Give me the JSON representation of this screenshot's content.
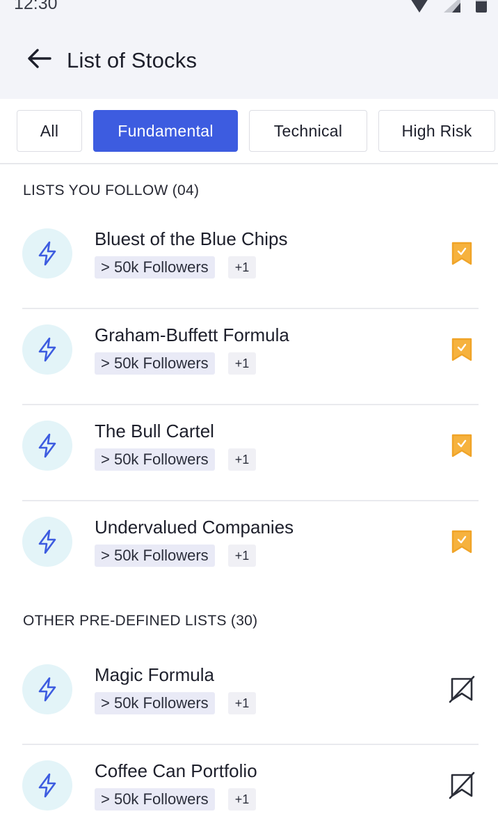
{
  "status_bar": {
    "time": "12:30",
    "icons": [
      "wifi-icon",
      "cell-signal-icon",
      "battery-icon"
    ]
  },
  "header": {
    "back_icon": "arrow-left-icon",
    "title": "List of Stocks"
  },
  "tabs": [
    {
      "label": "All",
      "active": false
    },
    {
      "label": "Fundamental",
      "active": true
    },
    {
      "label": "Technical",
      "active": false
    },
    {
      "label": "High Risk",
      "active": false
    }
  ],
  "sections": {
    "followed": {
      "title": "LISTS YOU FOLLOW (04)",
      "items": [
        {
          "title": "Bluest of the Blue Chips",
          "followers": "> 50k Followers",
          "extra": "+1",
          "icon": "lightning-icon",
          "action_icon": "bookmark-filled-icon"
        },
        {
          "title": "Graham-Buffett Formula",
          "followers": "> 50k Followers",
          "extra": "+1",
          "icon": "lightning-icon",
          "action_icon": "bookmark-filled-icon"
        },
        {
          "title": "The Bull Cartel",
          "followers": "> 50k Followers",
          "extra": "+1",
          "icon": "lightning-icon",
          "action_icon": "bookmark-filled-icon"
        },
        {
          "title": "Undervalued Companies",
          "followers": "> 50k Followers",
          "extra": "+1",
          "icon": "lightning-icon",
          "action_icon": "bookmark-filled-icon"
        }
      ]
    },
    "predefined": {
      "title": "OTHER PRE-DEFINED LISTS (30)",
      "items": [
        {
          "title": "Magic Formula",
          "followers": "> 50k Followers",
          "extra": "+1",
          "icon": "lightning-icon",
          "action_icon": "bookmark-off-icon"
        },
        {
          "title": "Coffee Can Portfolio",
          "followers": "> 50k Followers",
          "extra": "+1",
          "icon": "lightning-icon",
          "action_icon": "bookmark-off-icon"
        }
      ]
    }
  },
  "colors": {
    "accent": "#3d5ce0",
    "bookmark": "#f6b23e",
    "icon_bg": "#e3f4f8",
    "header_bg": "#f3f4f9"
  }
}
